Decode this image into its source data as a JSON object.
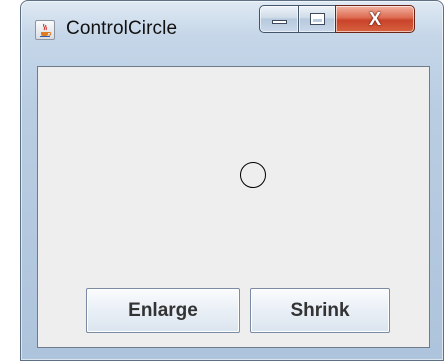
{
  "window": {
    "title": "ControlCircle",
    "app_icon": "java-coffee-icon",
    "controls": {
      "minimize_icon": "minimize-icon",
      "maximize_icon": "maximize-icon",
      "close_label": "X"
    }
  },
  "canvas": {
    "shape": "circle"
  },
  "buttons": {
    "enlarge_label": "Enlarge",
    "shrink_label": "Shrink"
  },
  "colors": {
    "client_background": "#eeeeee",
    "close_button": "#c9432a",
    "circle_stroke": "#000000"
  }
}
